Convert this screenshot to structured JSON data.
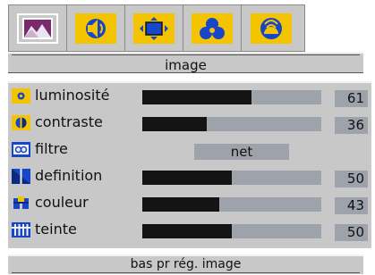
{
  "tabs": [
    {
      "icon": "picture-icon",
      "active": true
    },
    {
      "icon": "speaker-sound-icon",
      "active": false
    },
    {
      "icon": "screen-arrows-icon",
      "active": false
    },
    {
      "icon": "tri-circle-icon",
      "active": false
    },
    {
      "icon": "signal-dome-icon",
      "active": false
    }
  ],
  "title": "image",
  "settings": [
    {
      "label": "luminosité",
      "icon": "brightness-icon",
      "value": "61",
      "level": 0.61
    },
    {
      "label": "contraste",
      "icon": "contrast-icon",
      "value": "36",
      "level": 0.36
    },
    {
      "label": "filtre",
      "icon": "filter-icon",
      "option": "net"
    },
    {
      "label": "definition",
      "icon": "sharpness-icon",
      "value": "50",
      "level": 0.5
    },
    {
      "label": "couleur",
      "icon": "color-icon",
      "value": "43",
      "level": 0.43
    },
    {
      "label": "teinte",
      "icon": "tint-icon",
      "value": "50",
      "level": 0.5
    }
  ],
  "footer": "bas pr rég. image",
  "colors": {
    "panel": "#c8c8c8",
    "bar_track": "#9ea2ab",
    "bar_fill": "#141414",
    "accent": "#f5c400",
    "icon_blue": "#1846c8"
  }
}
